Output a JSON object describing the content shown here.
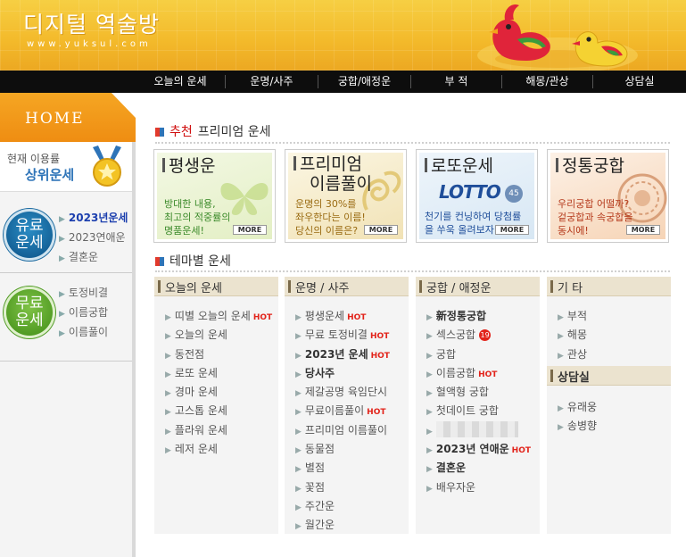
{
  "header": {
    "logo_title": "디지털 역술방",
    "logo_sub": "www.yuksul.com"
  },
  "topnav": [
    "오늘의 운세",
    "운명/사주",
    "궁합/애정운",
    "부 적",
    "해몽/관상",
    "상담실"
  ],
  "sidebar": {
    "home_label": "HOME",
    "rank_line1": "현재 이용률",
    "rank_line2": "상위운세",
    "paid_badge": "유료 운세",
    "paid_items": [
      "2023년운세",
      "2023연애운",
      "결혼운"
    ],
    "free_badge": "무료 운세",
    "free_items": [
      "토정비결",
      "이름궁합",
      "이름풀이"
    ]
  },
  "recommend": {
    "title_red": "추천",
    "title_rest": "프리미엄 운세",
    "cards": [
      {
        "title": "평생운",
        "desc": [
          "방대한 내용,",
          "최고의 적중률의",
          "명품운세!"
        ],
        "more": "MORE",
        "color": "#3b8a2a"
      },
      {
        "title": "프리미엄 이름풀이",
        "title_lines": [
          "프리미엄",
          "이름풀이"
        ],
        "desc": [
          "운명의 30%를",
          "좌우한다는 이름!",
          "당신의 이름은?"
        ],
        "more": "MORE",
        "color": "#9a6b12"
      },
      {
        "title": "로또운세",
        "logo": "LOTTO",
        "logo_num": "45",
        "desc": [
          "천기를 컨닝하여 당첨률",
          "을 쑤욱 올려보자~"
        ],
        "more": "MORE",
        "color": "#1f4e9a"
      },
      {
        "title": "정통궁합",
        "desc": [
          "우리궁합 어떨까?",
          "겉궁합과 속궁합을",
          "동시에!"
        ],
        "more": "MORE",
        "color": "#b53a1c"
      }
    ]
  },
  "theme": {
    "title": "테마별 운세",
    "columns": [
      {
        "header": "오늘의 운세",
        "items": [
          {
            "label": "띠별 오늘의 운세",
            "hot": "HOT"
          },
          {
            "label": "오늘의 운세"
          },
          {
            "label": "동전점"
          },
          {
            "label": "로또 운세"
          },
          {
            "label": "경마 운세"
          },
          {
            "label": "고스톱 운세"
          },
          {
            "label": "플라워 운세"
          },
          {
            "label": "레저 운세"
          }
        ]
      },
      {
        "header": "운명 / 사주",
        "items": [
          {
            "label": "평생운세",
            "hot": "HOT"
          },
          {
            "label": "무료 토정비결",
            "hot": "HOT"
          },
          {
            "label": "2023년 운세",
            "hot": "HOT",
            "bold": true
          },
          {
            "label": "당사주",
            "bold": true
          },
          {
            "label": "제갈공명 육임단시"
          },
          {
            "label": "무료이름풀이",
            "hot": "HOT"
          },
          {
            "label": "프리미엄 이름풀이"
          },
          {
            "label": "동물점"
          },
          {
            "label": "별점"
          },
          {
            "label": "꽃점"
          },
          {
            "label": "주간운"
          },
          {
            "label": "월간운"
          }
        ]
      },
      {
        "header": "궁합 / 애정운",
        "items": [
          {
            "label": "新정통궁합",
            "bold": true
          },
          {
            "label": "섹스궁합",
            "badge": "19"
          },
          {
            "label": "궁합"
          },
          {
            "label": "이름궁합",
            "hot": "HOT"
          },
          {
            "label": "혈액형 궁합"
          },
          {
            "label": "첫데이트 궁합"
          },
          {
            "label": "",
            "blurred": true
          },
          {
            "label": "2023년 연애운",
            "hot": "HOT",
            "bold": true
          },
          {
            "label": "결혼운",
            "bold": true
          },
          {
            "label": "배우자운"
          }
        ]
      },
      {
        "header": "기  타",
        "items": [
          {
            "label": "부적"
          },
          {
            "label": "해몽"
          },
          {
            "label": "관상"
          }
        ],
        "sub_header": "상담실",
        "sub_items": [
          {
            "label": "유래웅"
          },
          {
            "label": "송병향"
          }
        ]
      }
    ]
  }
}
